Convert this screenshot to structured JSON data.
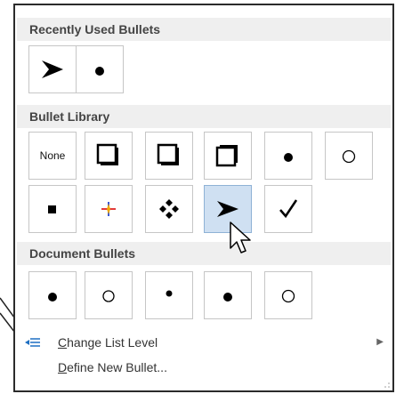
{
  "sections": {
    "recent": {
      "title": "Recently Used Bullets"
    },
    "library": {
      "title": "Bullet Library",
      "none_label": "None"
    },
    "document": {
      "title": "Document Bullets"
    }
  },
  "menu_items": {
    "change_level": {
      "mnemonic": "C",
      "rest": "hange List Level"
    },
    "define_new": {
      "mnemonic": "D",
      "rest": "efine New Bullet..."
    }
  },
  "selected_bullet": "arrowhead-library",
  "colors": {
    "border": "#2b2b2b",
    "header_bg": "#efefef",
    "selected_bg": "#cfe0f2",
    "selected_border": "#8fb2d6",
    "cell_border": "#c6c6c6"
  }
}
